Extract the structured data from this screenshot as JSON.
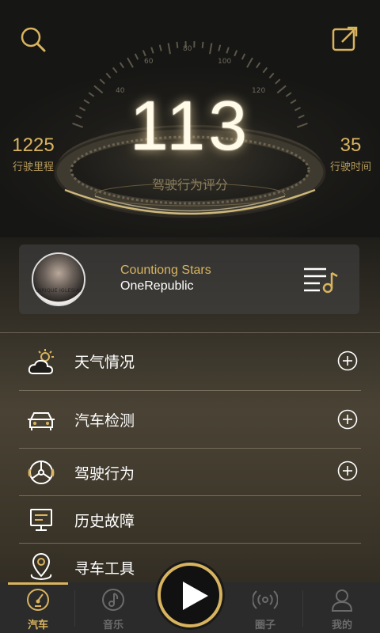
{
  "header": {
    "score": "113",
    "score_label": "驾驶行为评分",
    "gauge_ticks": [
      "40",
      "60",
      "80",
      "100",
      "120"
    ],
    "mileage": {
      "value": "1225",
      "label": "行驶里程"
    },
    "drive_time": {
      "value": "35",
      "label": "行驶时间"
    },
    "search_icon": "search-icon",
    "share_icon": "share-icon"
  },
  "music": {
    "title": "Countiong Stars",
    "artist": "OneRepublic",
    "album_caption": "ENRIQUE IGLESIAS",
    "playlist_icon": "playlist-music-icon"
  },
  "menu": [
    {
      "label": "天气情况",
      "icon": "weather-icon",
      "has_add": true
    },
    {
      "label": "汽车检测",
      "icon": "car-icon",
      "has_add": true
    },
    {
      "label": "驾驶行为",
      "icon": "steering-wheel-icon",
      "has_add": true
    },
    {
      "label": "历史故障",
      "icon": "monitor-icon",
      "has_add": false
    },
    {
      "label": "寻车工具",
      "icon": "location-pin-icon",
      "has_add": false
    }
  ],
  "tabs": [
    {
      "label": "汽车",
      "icon": "speedometer-icon",
      "active": true
    },
    {
      "label": "音乐",
      "icon": "music-note-icon",
      "active": false
    },
    {
      "label": "圈子",
      "icon": "broadcast-icon",
      "active": false
    },
    {
      "label": "我的",
      "icon": "user-icon",
      "active": false
    }
  ],
  "colors": {
    "accent": "#d9b45f",
    "text": "#ffffff",
    "muted": "#6b6b6b"
  }
}
